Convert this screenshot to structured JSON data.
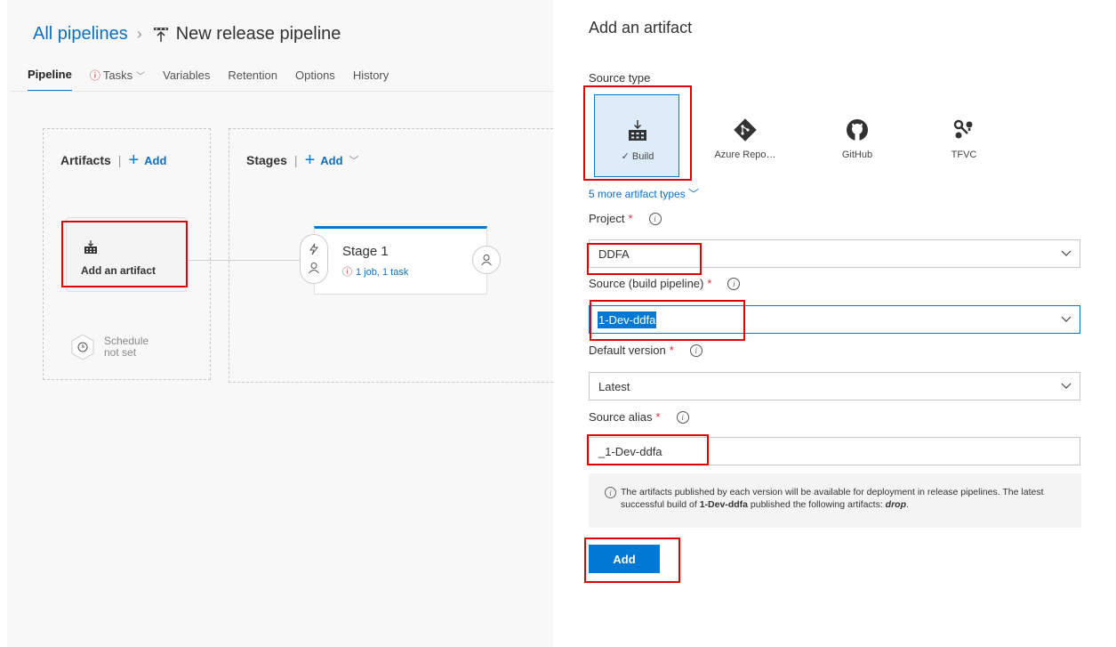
{
  "breadcrumb": {
    "root": "All pipelines",
    "separator": "›",
    "current": "New release pipeline"
  },
  "tabs": [
    {
      "label": "Pipeline",
      "active": true
    },
    {
      "label": "Tasks",
      "warning": true,
      "dropdown": true
    },
    {
      "label": "Variables"
    },
    {
      "label": "Retention"
    },
    {
      "label": "Options"
    },
    {
      "label": "History"
    }
  ],
  "artifacts_section": {
    "title": "Artifacts",
    "add_label": "Add"
  },
  "stages_section": {
    "title": "Stages",
    "add_label": "Add"
  },
  "artifact_card": {
    "label": "Add an artifact"
  },
  "stage_card": {
    "name": "Stage 1",
    "meta": "1 job, 1 task"
  },
  "schedule": {
    "line1": "Schedule",
    "line2": "not set"
  },
  "panel": {
    "title": "Add an artifact",
    "source_type_label": "Source type",
    "source_types": [
      {
        "label": "Build",
        "selected": true,
        "icon": "build-icon"
      },
      {
        "label": "Azure Repo…",
        "icon": "git-icon"
      },
      {
        "label": "GitHub",
        "icon": "github-icon"
      },
      {
        "label": "TFVC",
        "icon": "tfvc-icon"
      }
    ],
    "more_types": "5 more artifact types",
    "project": {
      "label": "Project",
      "value": "DDFA"
    },
    "source": {
      "label": "Source (build pipeline)",
      "value": "1-Dev-ddfa"
    },
    "default_version": {
      "label": "Default version",
      "value": "Latest"
    },
    "source_alias": {
      "label": "Source alias",
      "value": "_1-Dev-ddfa"
    },
    "info": {
      "text_before": "The artifacts published by each version will be available for deployment in release pipelines. The latest successful build of ",
      "pipeline": "1-Dev-ddfa",
      "text_middle": "  published the following artifacts: ",
      "artifact": "drop",
      "text_after": "."
    },
    "add_button": "Add"
  },
  "colors": {
    "accent": "#0078d4",
    "highlight": "#e00000",
    "warning": "#d13438"
  }
}
